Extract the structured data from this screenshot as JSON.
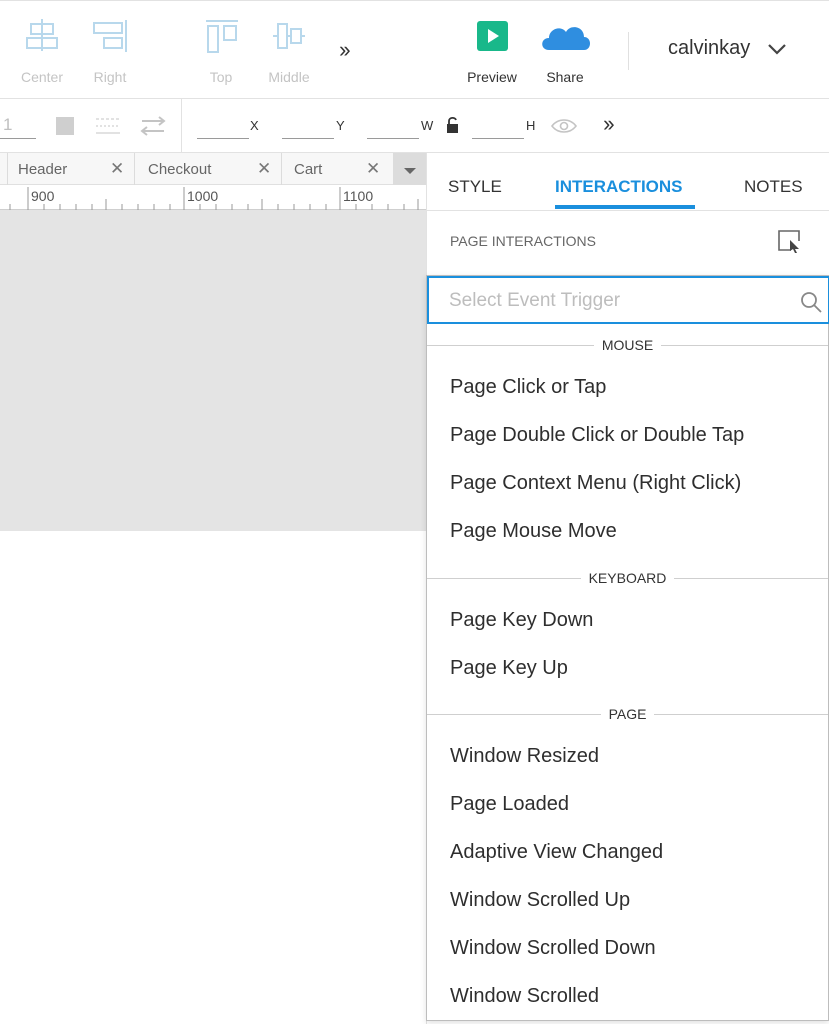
{
  "toolbar": {
    "align_center": "Center",
    "align_right": "Right",
    "align_top": "Top",
    "align_middle": "Middle",
    "preview": "Preview",
    "share": "Share",
    "username": "calvinkay",
    "colors": {
      "preview": "#19b88a",
      "share": "#2f8ee0",
      "disabled": "#c4c4c4"
    }
  },
  "properties": {
    "line_weight": "1",
    "x_label": "X",
    "y_label": "Y",
    "w_label": "W",
    "h_label": "H"
  },
  "canvas": {
    "tabs": [
      {
        "label": "Header"
      },
      {
        "label": "Checkout"
      },
      {
        "label": "Cart"
      }
    ],
    "ruler_labels": [
      "900",
      "1000",
      "1100"
    ]
  },
  "panel": {
    "tabs": [
      "STYLE",
      "INTERACTIONS",
      "NOTES"
    ],
    "active_tab": "INTERACTIONS",
    "section_title": "PAGE INTERACTIONS",
    "accent": "#1a8fdd"
  },
  "dropdown": {
    "placeholder": "Select Event Trigger",
    "groups": [
      {
        "title": "MOUSE",
        "items": [
          "Page Click or Tap",
          "Page Double Click or Double Tap",
          "Page Context Menu (Right Click)",
          "Page Mouse Move"
        ]
      },
      {
        "title": "KEYBOARD",
        "items": [
          "Page Key Down",
          "Page Key Up"
        ]
      },
      {
        "title": "PAGE",
        "items": [
          "Window Resized",
          "Page Loaded",
          "Adaptive View Changed",
          "Window Scrolled Up",
          "Window Scrolled Down",
          "Window Scrolled"
        ]
      }
    ]
  }
}
